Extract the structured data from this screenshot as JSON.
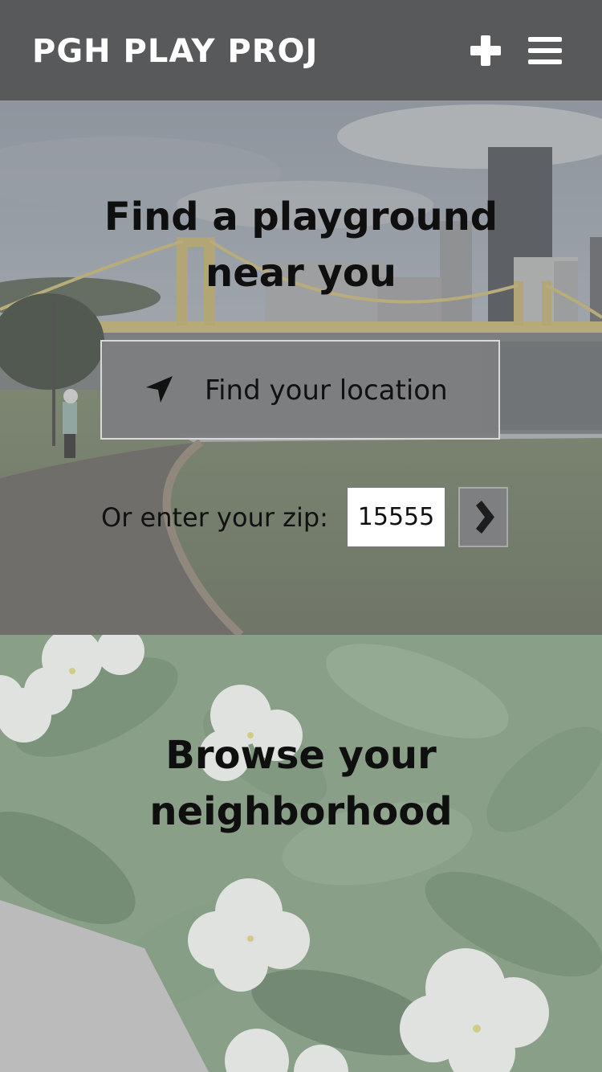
{
  "header": {
    "brand": "PGH PLAY PROJ",
    "add_icon": "plus-icon",
    "menu_icon": "hamburger-menu-icon",
    "background_color": "#58595b"
  },
  "hero": {
    "title_line1": "Find a playground",
    "title_line2": "near you",
    "locate_button_label": "Find your location",
    "locate_icon": "location-arrow-icon",
    "zip_label": "Or enter your zip:",
    "zip_value": "15555",
    "zip_submit_icon": "chevron-right-icon"
  },
  "browse": {
    "title_line1": "Browse your",
    "title_line2": "neighborhood"
  }
}
